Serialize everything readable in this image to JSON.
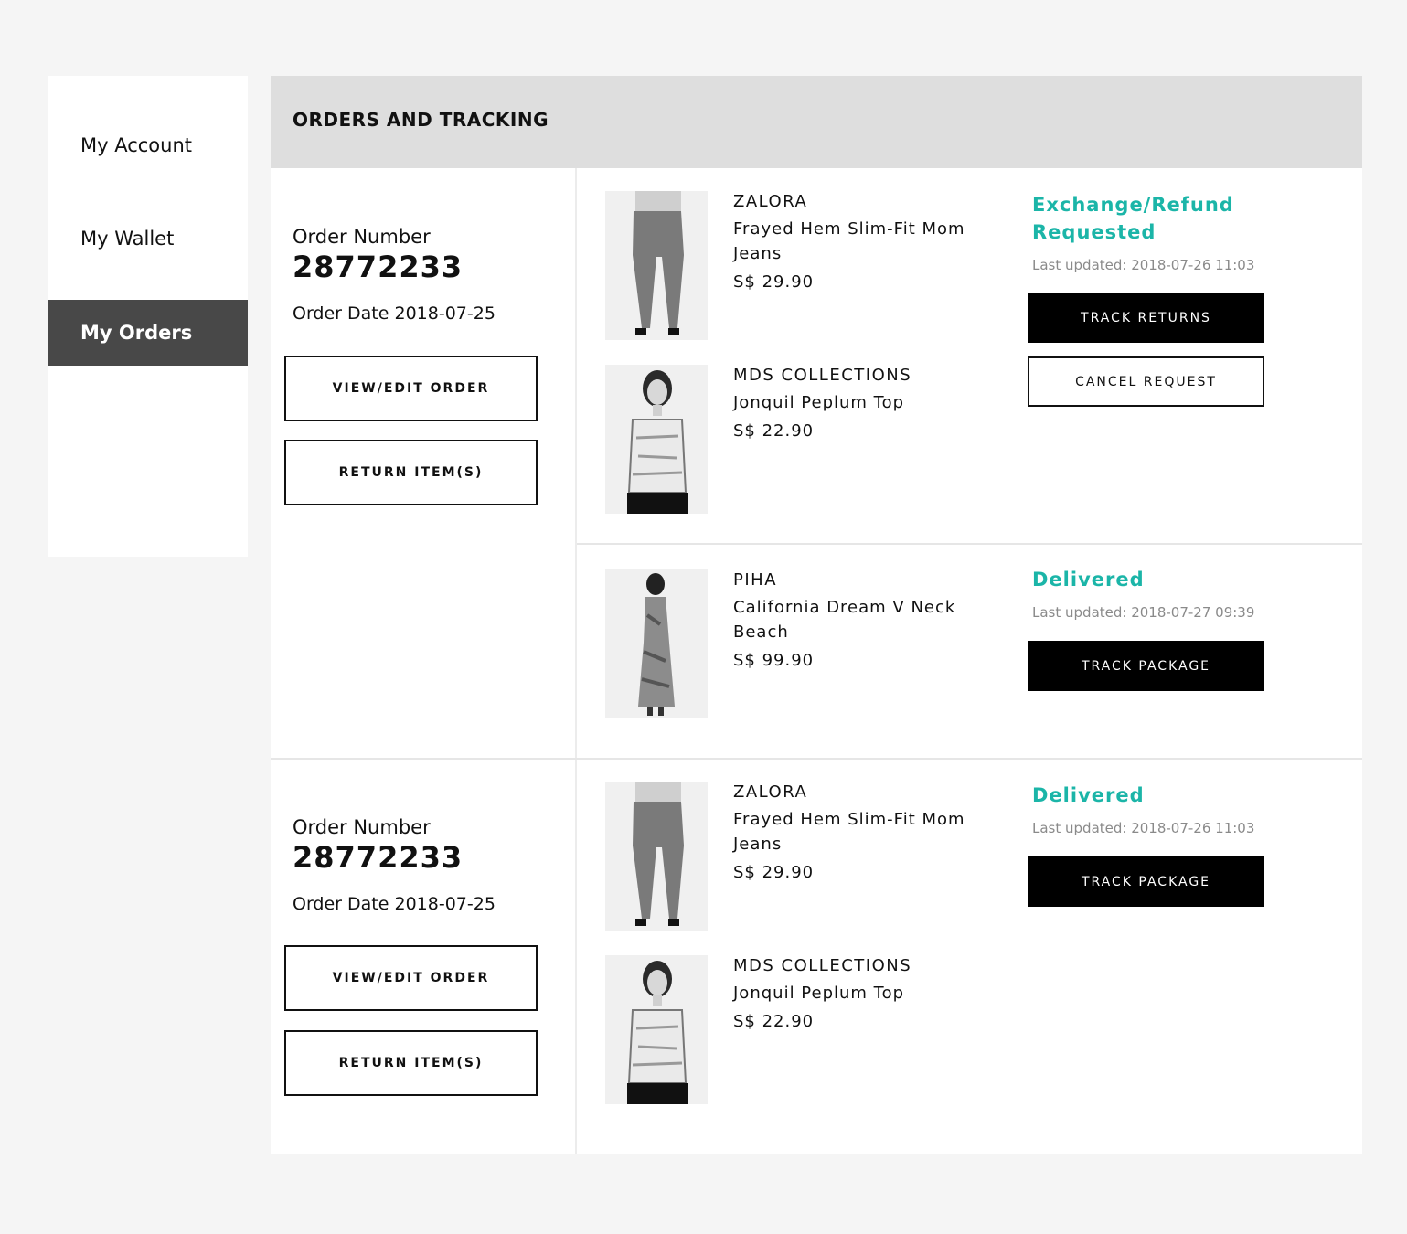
{
  "sidebar": {
    "items": [
      {
        "label": "My Account"
      },
      {
        "label": "My Wallet"
      },
      {
        "label": "My Orders"
      }
    ]
  },
  "main": {
    "title": "ORDERS AND TRACKING"
  },
  "orders": [
    {
      "number_label": "Order Number",
      "number": "28772233",
      "date": "Order Date 2018-07-25",
      "view_edit_label": "VIEW/EDIT ORDER",
      "return_label": "RETURN ITEM(S)",
      "shipments": [
        {
          "status": "Exchange/Refund Requested",
          "updated": "Last updated: 2018-07-26 11:03",
          "primary_action": "TRACK RETURNS",
          "secondary_action": "CANCEL REQUEST",
          "items": [
            {
              "brand": "ZALORA",
              "name": "Frayed Hem Slim-Fit Mom Jeans",
              "price": "S$ 29.90"
            },
            {
              "brand": "MDS COLLECTIONS",
              "name": "Jonquil Peplum Top",
              "price": "S$ 22.90"
            }
          ]
        },
        {
          "status": "Delivered",
          "updated": "Last updated: 2018-07-27 09:39",
          "primary_action": "TRACK PACKAGE",
          "items": [
            {
              "brand": "PIHA",
              "name": "California Dream V Neck Beach",
              "price": "S$ 99.90"
            }
          ]
        }
      ]
    },
    {
      "number_label": "Order Number",
      "number": "28772233",
      "date": "Order Date 2018-07-25",
      "view_edit_label": "VIEW/EDIT ORDER",
      "return_label": "RETURN ITEM(S)",
      "shipments": [
        {
          "status": "Delivered",
          "updated": "Last updated: 2018-07-26 11:03",
          "primary_action": "TRACK PACKAGE",
          "items": [
            {
              "brand": "ZALORA",
              "name": "Frayed Hem Slim-Fit Mom Jeans",
              "price": "S$ 29.90"
            },
            {
              "brand": "MDS COLLECTIONS",
              "name": "Jonquil Peplum Top",
              "price": "S$ 22.90"
            }
          ]
        }
      ]
    }
  ],
  "colors": {
    "accent": "#1bb5a8",
    "sidebar_active": "#484848",
    "header_bg": "#dedede"
  }
}
